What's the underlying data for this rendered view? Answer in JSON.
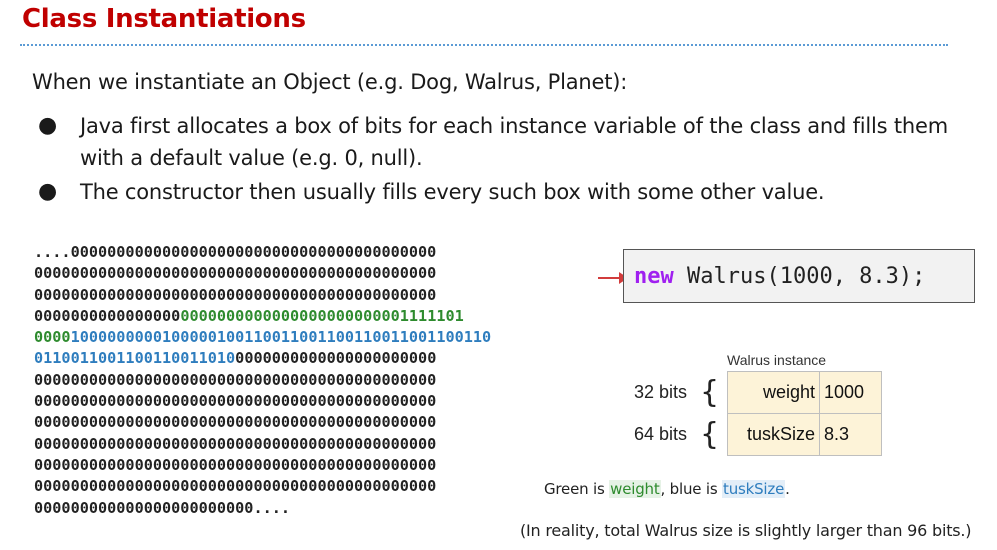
{
  "title": "Class Instantiations",
  "intro": "When we instantiate an Object (e.g. Dog, Walrus, Planet):",
  "bullets": [
    "Java first allocates a box of bits for each instance variable of the class and fills them with a default value (e.g. 0, null).",
    "The constructor then usually fills every such box with some other value."
  ],
  "bullet_symbol": "●",
  "memory_bits": [
    [
      {
        "text": "....0000000000000000000000000000000000000000",
        "c": ""
      }
    ],
    [
      {
        "text": "00000000000000000000000000000000000000000000",
        "c": ""
      }
    ],
    [
      {
        "text": "00000000000000000000000000000000000000000000",
        "c": ""
      }
    ],
    [
      {
        "text": "0000000000000000",
        "c": ""
      },
      {
        "text": "0000000000000000000000001111101",
        "c": "g"
      }
    ],
    [
      {
        "text": "0000",
        "c": "g"
      },
      {
        "text": "1000000000100000100110011001100110011001100110",
        "c": "b"
      }
    ],
    [
      {
        "text": "0110011001100110011010",
        "c": "b"
      },
      {
        "text": "0000000000000000000000",
        "c": ""
      }
    ],
    [
      {
        "text": "00000000000000000000000000000000000000000000",
        "c": ""
      }
    ],
    [
      {
        "text": "00000000000000000000000000000000000000000000",
        "c": ""
      }
    ],
    [
      {
        "text": "00000000000000000000000000000000000000000000",
        "c": ""
      }
    ],
    [
      {
        "text": "00000000000000000000000000000000000000000000",
        "c": ""
      }
    ],
    [
      {
        "text": "00000000000000000000000000000000000000000000",
        "c": ""
      }
    ],
    [
      {
        "text": "00000000000000000000000000000000000000000000",
        "c": ""
      }
    ],
    [
      {
        "text": "000000000000000000000000....",
        "c": ""
      }
    ]
  ],
  "code": {
    "keyword": "new",
    "expression": " Walrus(1000, 8.3);"
  },
  "instance": {
    "label": "Walrus instance",
    "fields": [
      {
        "name": "weight",
        "value": "1000",
        "bits": "32 bits"
      },
      {
        "name": "tuskSize",
        "value": "8.3",
        "bits": "64 bits"
      }
    ]
  },
  "legend": {
    "prefix": "Green is ",
    "green_word": "weight",
    "middle": ", blue is ",
    "blue_word": "tuskSize",
    "suffix": "."
  },
  "footnote": "(In reality, total Walrus size is slightly larger than 96 bits.)",
  "colors": {
    "title": "#c00000",
    "weight_bits": "#2e8b2e",
    "tusk_bits": "#2e7dbe",
    "keyword": "#a020f0",
    "arrow": "#d23c3c",
    "cell_fill": "#fdf3d8"
  }
}
